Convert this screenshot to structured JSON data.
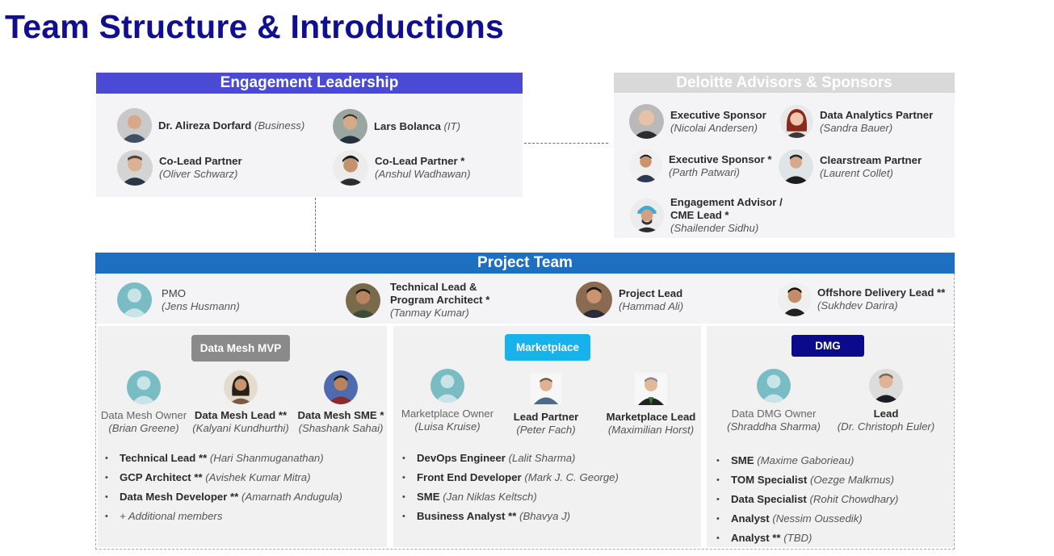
{
  "title": "Team Structure & Introductions",
  "colors": {
    "title": "#0f0f8f",
    "engagement_header": "#4a4ad4",
    "advisors_header": "#d9d9d9",
    "project_header": "#1f6fc0",
    "data_mesh_btn": "#8a8a8a",
    "marketplace_btn": "#17b1ec",
    "dmg_btn": "#0a0a8a"
  },
  "engagement": {
    "header": "Engagement Leadership",
    "people": [
      {
        "role": "Dr. Alireza Dorfard",
        "name": "(Business)"
      },
      {
        "role": "Lars Bolanca",
        "name": "(IT)"
      },
      {
        "role": "Co-Lead Partner",
        "name": "(Oliver Schwarz)"
      },
      {
        "role": "Co-Lead Partner *",
        "name": "(Anshul Wadhawan)"
      }
    ]
  },
  "advisors": {
    "header": "Deloitte Advisors & Sponsors",
    "people": [
      {
        "role": "Executive Sponsor",
        "name": "(Nicolai Andersen)"
      },
      {
        "role": "Data Analytics Partner",
        "name": "(Sandra Bauer)"
      },
      {
        "role": "Executive Sponsor *",
        "name": "(Parth Patwari)"
      },
      {
        "role": "Clearstream Partner",
        "name": "(Laurent Collet)"
      },
      {
        "role_line1": "Engagement Advisor /",
        "role_line2": "CME Lead *",
        "name": "(Shailender Sidhu)"
      }
    ]
  },
  "project": {
    "header": "Project Team",
    "leads": [
      {
        "role": "PMO",
        "name": "(Jens Husmann)"
      },
      {
        "role_line1": "Technical Lead &",
        "role_line2": "Program Architect *",
        "name": "(Tanmay Kumar)"
      },
      {
        "role": "Project Lead",
        "name": "(Hammad Ali)"
      },
      {
        "role": "Offshore Delivery Lead **",
        "name": "(Sukhdev Darira)"
      }
    ]
  },
  "data_mesh": {
    "label": "Data Mesh MVP",
    "people": [
      {
        "role": "Data Mesh Owner",
        "name": "(Brian Greene)"
      },
      {
        "role": "Data Mesh Lead **",
        "name": "(Kalyani Kundhurthi)"
      },
      {
        "role": "Data Mesh SME *",
        "name": "(Shashank Sahai)"
      }
    ],
    "members": [
      {
        "role": "Technical Lead **",
        "name": "(Hari Shanmuganathan)"
      },
      {
        "role": "GCP Architect **",
        "name": "(Avishek Kumar Mitra)"
      },
      {
        "role": "Data Mesh Developer **",
        "name": "(Amarnath Andugula)"
      }
    ],
    "additional": "+ Additional members"
  },
  "marketplace": {
    "label": "Marketplace",
    "people": [
      {
        "role": "Marketplace Owner",
        "name": "(Luisa Kruise)"
      },
      {
        "role": "Lead Partner",
        "name": "(Peter Fach)"
      },
      {
        "role": "Marketplace Lead",
        "name": "(Maximilian Horst)"
      }
    ],
    "members": [
      {
        "role": "DevOps Engineer",
        "name": "(Lalit Sharma)"
      },
      {
        "role": "Front End Developer",
        "name": "(Mark J. C. George)"
      },
      {
        "role": "SME",
        "name": "(Jan Niklas Keltsch)"
      },
      {
        "role": "Business Analyst **",
        "name": "(Bhavya J)"
      }
    ]
  },
  "dmg": {
    "label": "DMG",
    "people": [
      {
        "role": "Data DMG Owner",
        "name": "(Shraddha Sharma)"
      },
      {
        "role": "Lead",
        "name": "(Dr. Christoph Euler)"
      }
    ],
    "members": [
      {
        "role": "SME",
        "name": "(Maxime Gaborieau)"
      },
      {
        "role": "TOM Specialist",
        "name": "(Oezge Malkmus)"
      },
      {
        "role": "Data Specialist",
        "name": "(Rohit Chowdhary)"
      },
      {
        "role": "Analyst",
        "name": "(Nessim Oussedik)"
      },
      {
        "role": "Analyst **",
        "name": "(TBD)"
      }
    ]
  }
}
